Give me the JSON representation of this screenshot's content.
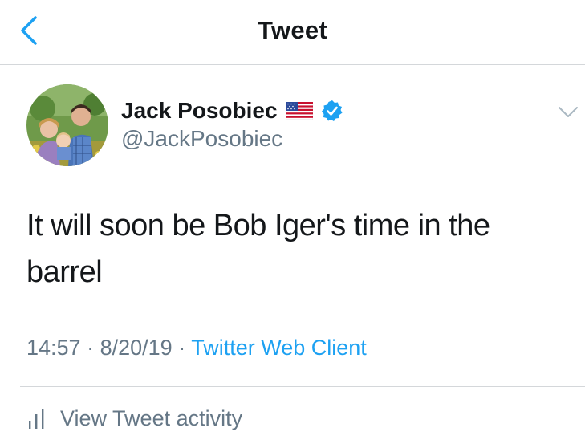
{
  "nav": {
    "title": "Tweet",
    "back_icon": "chevron-left-icon"
  },
  "tweet": {
    "author": {
      "name": "Jack Posobiec",
      "handle": "@JackPosobiec",
      "flag_icon": "us-flag-emoji",
      "verified_icon": "verified-badge-icon"
    },
    "text": "It will soon be Bob Iger's time in the barrel",
    "time": "14:57",
    "separator": "·",
    "date": "8/20/19",
    "source": "Twitter Web Client"
  },
  "activity": {
    "label": "View Tweet activity",
    "icon": "bar-chart-icon"
  },
  "colors": {
    "accent": "#1da1f2",
    "secondary_text": "#657786",
    "divider": "#d4d7da"
  }
}
